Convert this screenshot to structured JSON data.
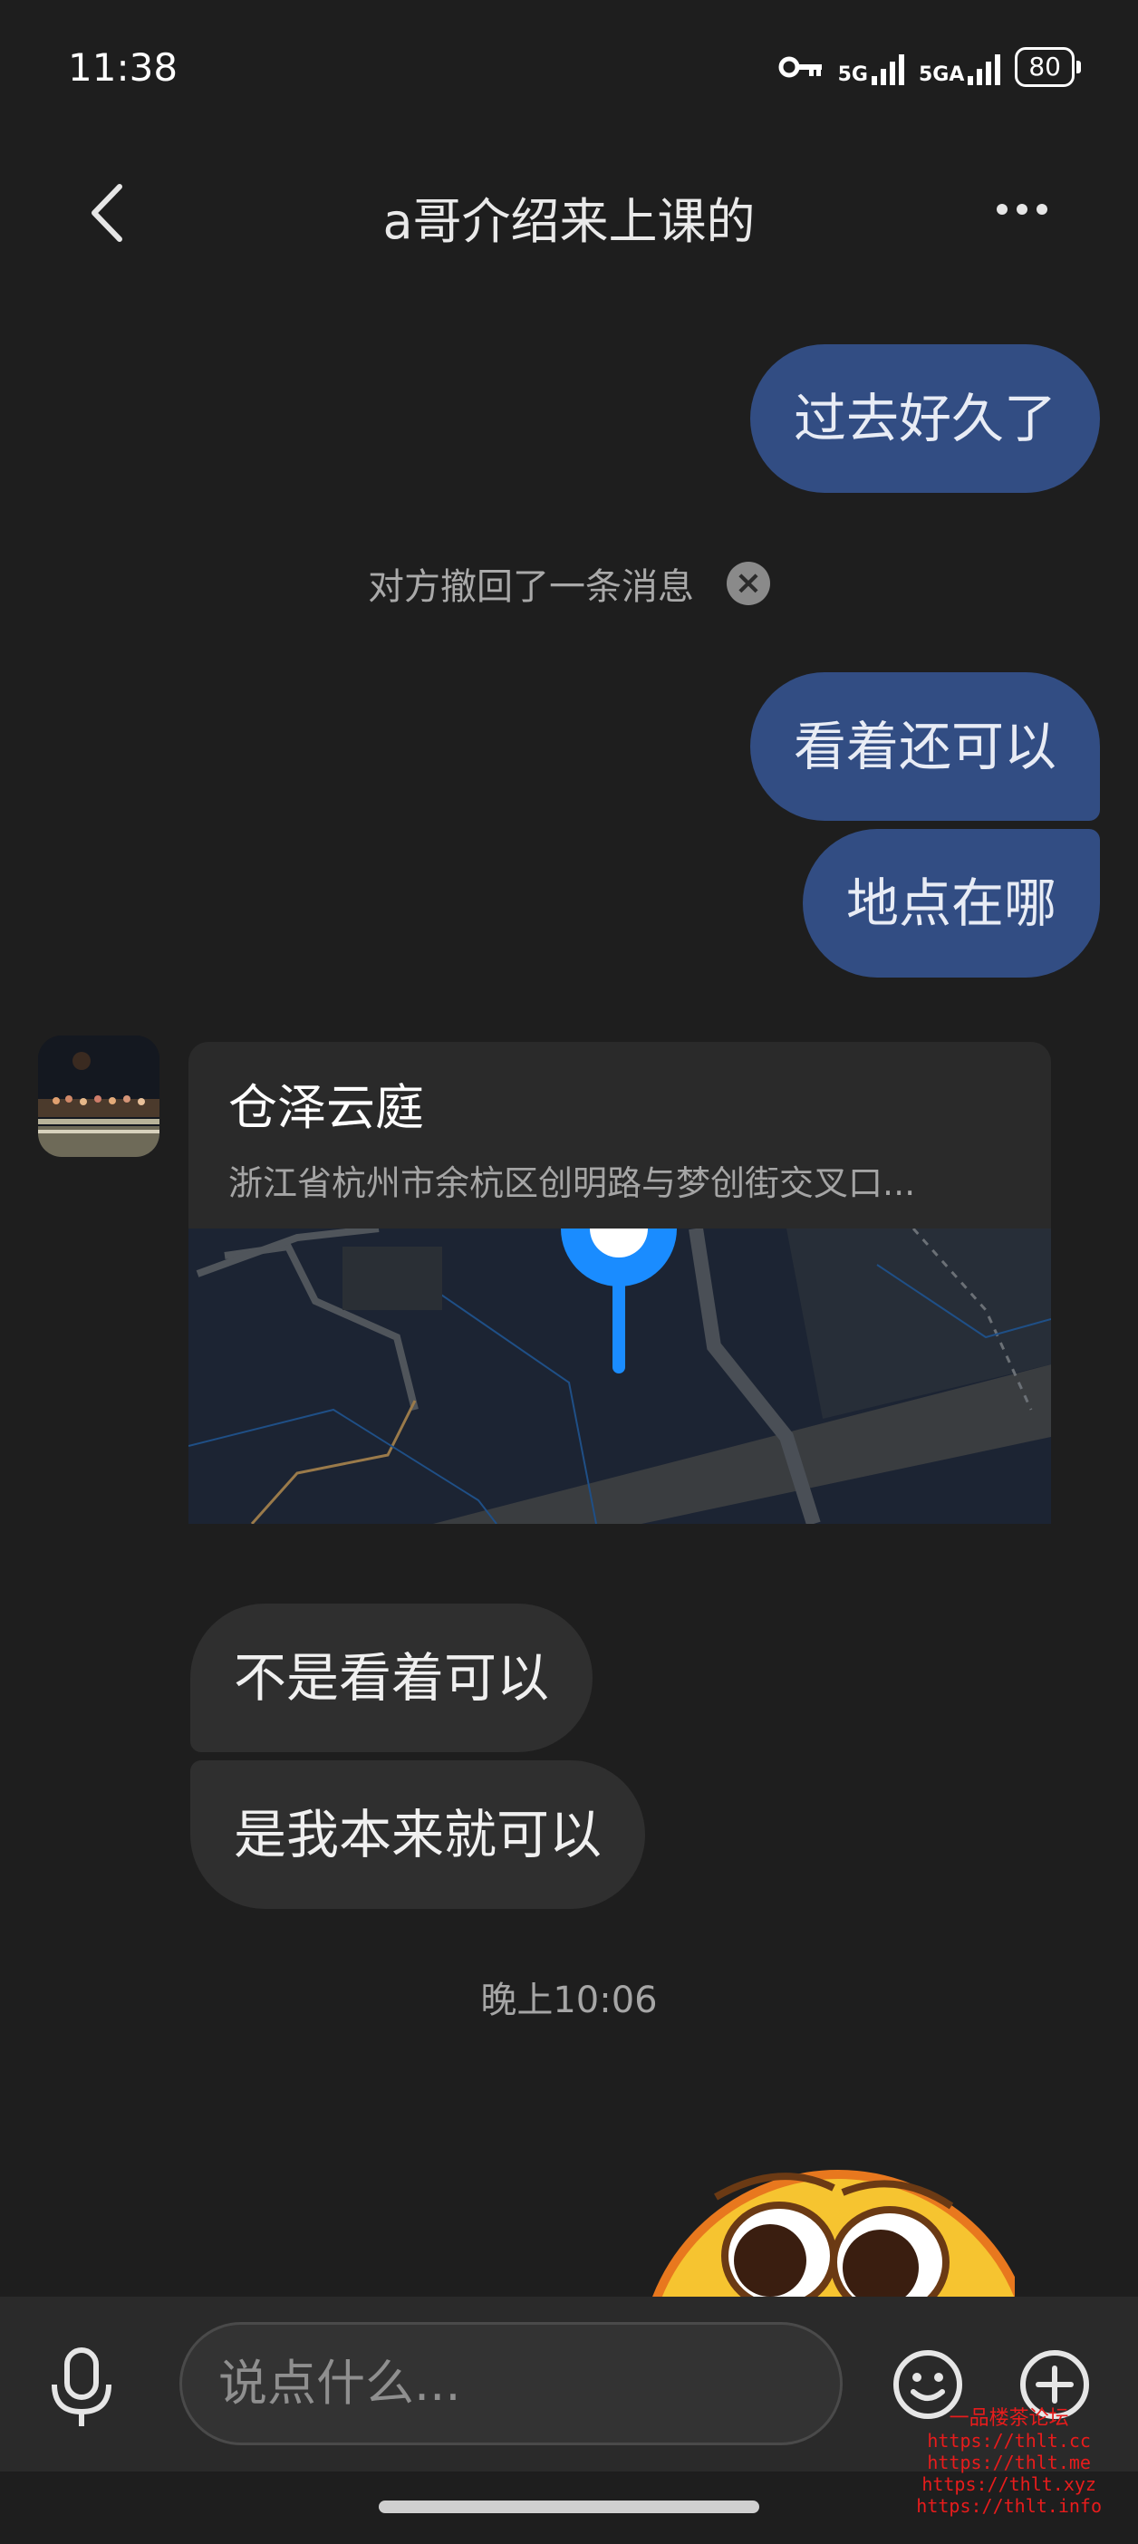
{
  "status_bar": {
    "time": "11:38",
    "network1": "5G",
    "network2": "5GA",
    "battery": "80"
  },
  "header": {
    "title": "a哥介绍来上课的"
  },
  "messages": {
    "out1": "过去好久了",
    "recalled_notice": "对方撤回了一条消息",
    "out2": "看着还可以",
    "out3": "地点在哪",
    "location": {
      "name": "仓泽云庭",
      "address": "浙江省杭州市余杭区创明路与梦创街交叉口..."
    },
    "in1": "不是看着可以",
    "in2": "是我本来就可以",
    "timestamp": "晚上10:06"
  },
  "input": {
    "placeholder": "说点什么..."
  },
  "watermark": {
    "title": "一品楼茶论坛",
    "lines": [
      "https://thlt.cc",
      "https://thlt.me",
      "https://thlt.xyz",
      "https://thlt.info"
    ]
  },
  "colors": {
    "background": "#1e1e1e",
    "outgoing_bubble": "#324d83",
    "incoming_bubble": "#2f2f2f",
    "map_pin": "#1a8cff"
  }
}
